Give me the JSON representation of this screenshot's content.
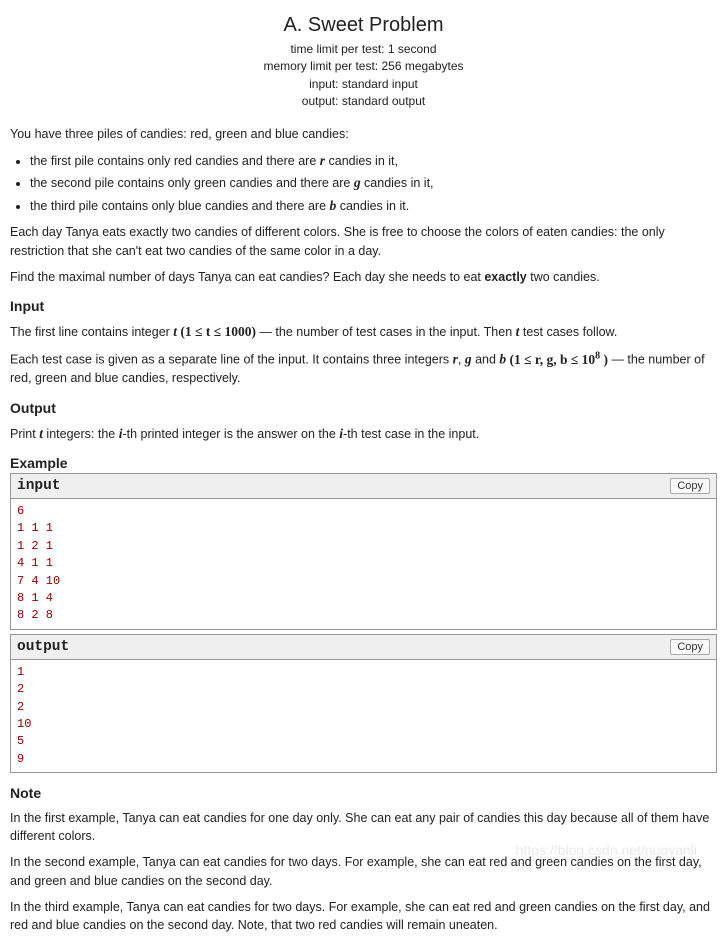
{
  "title": "A. Sweet Problem",
  "limits": {
    "time": "time limit per test: 1 second",
    "memory": "memory limit per test: 256 megabytes",
    "input": "input: standard input",
    "output": "output: standard output"
  },
  "intro": "You have three piles of candies: red, green and blue candies:",
  "bullets": [
    {
      "prefix": "the first pile contains only red candies and there are ",
      "var": "r",
      "suffix": " candies in it,"
    },
    {
      "prefix": "the second pile contains only green candies and there are ",
      "var": "g",
      "suffix": " candies in it,"
    },
    {
      "prefix": "the third pile contains only blue candies and there are ",
      "var": "b",
      "suffix": " candies in it."
    }
  ],
  "para_rule": "Each day Tanya eats exactly two candies of different colors. She is free to choose the colors of eaten candies: the only restriction that she can't eat two candies of the same color in a day.",
  "para_find_a": "Find the maximal number of days Tanya can eat candies? Each day she needs to eat ",
  "para_find_bold": "exactly",
  "para_find_b": " two candies.",
  "sections": {
    "input": "Input",
    "output": "Output",
    "example": "Example",
    "note": "Note"
  },
  "input_line1": {
    "a": "The first line contains integer ",
    "expr_t": "t",
    "expr_range": " (1 ≤ t ≤ 1000)",
    "b": " — the number of test cases in the input. Then ",
    "c": " test cases follow."
  },
  "input_line2": {
    "a": "Each test case is given as a separate line of the input. It contains three integers ",
    "r": "r",
    "g": "g",
    "b_var": "b",
    "and": " and ",
    "comma": ", ",
    "range_open": " (1 ≤ r, g, b ≤ 10",
    "exp": "8",
    "range_close": " )",
    "suffix": " — the number of red, green and blue candies, respectively."
  },
  "output_line": {
    "a": "Print ",
    "t": "t",
    "b": " integers: the ",
    "i": "i",
    "c": "-th printed integer is the answer on the ",
    "d": "-th test case in the input."
  },
  "example": {
    "input_label": "input",
    "output_label": "output",
    "copy_label": "Copy",
    "input_data": "6\n1 1 1\n1 2 1\n4 1 1\n7 4 10\n8 1 4\n8 2 8",
    "output_data": "1\n2\n2\n10\n5\n9"
  },
  "notes": [
    "In the first example, Tanya can eat candies for one day only. She can eat any pair of candies this day because all of them have different colors.",
    "In the second example, Tanya can eat candies for two days. For example, she can eat red and green candies on the first day, and green and blue candies on the second day.",
    "In the third example, Tanya can eat candies for two days. For example, she can eat red and green candies on the first day, and red and blue candies on the second day. Note, that two red candies will remain uneaten."
  ],
  "watermark": "https://blog.csdn.net/nuoyanli"
}
